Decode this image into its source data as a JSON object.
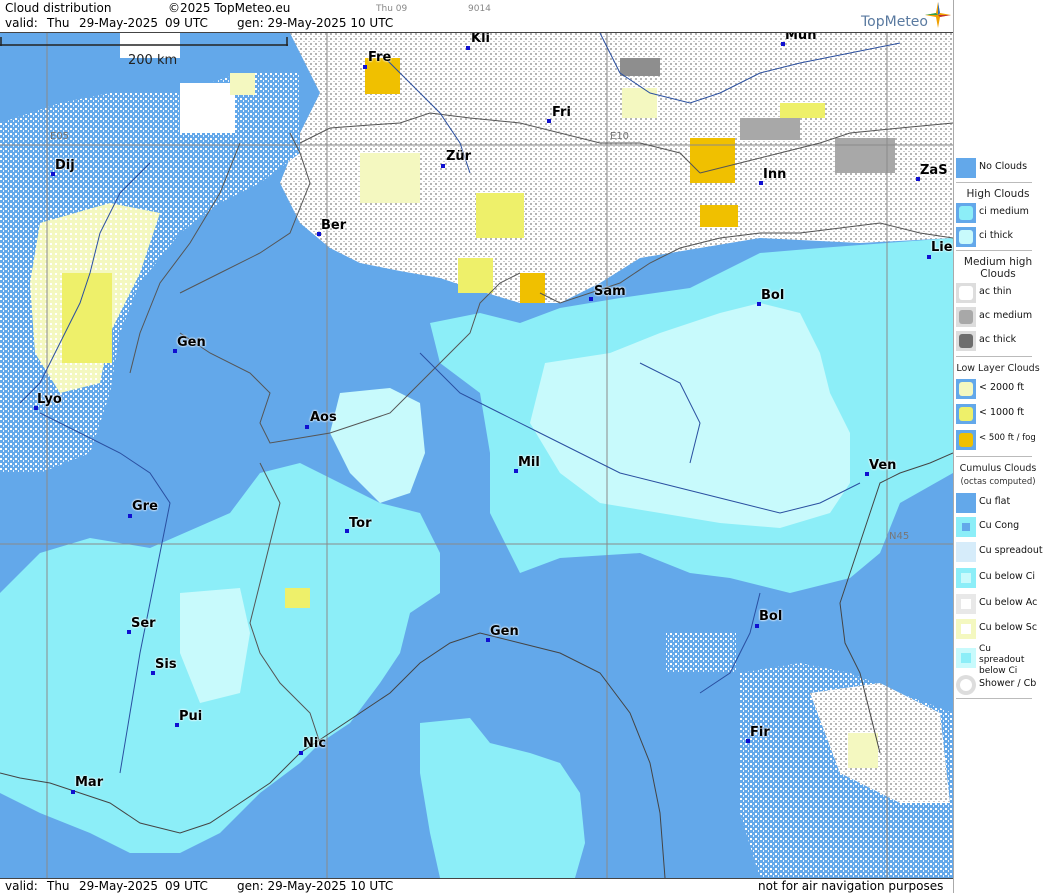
{
  "header": {
    "title": "Cloud distribution",
    "copyright": "©2025 TopMeteo.eu",
    "tiny_a": "Thu 09",
    "tiny_b": "9014",
    "valid_label": "valid:",
    "valid_day": "Thu",
    "valid_date": "29-May-2025",
    "valid_time": "09 UTC",
    "gen": "gen: 29-May-2025 10 UTC",
    "logo": "TopMeteo"
  },
  "scale": {
    "label": "200 km"
  },
  "grid": {
    "e05": "E05",
    "e10": "E10",
    "n45": "N45"
  },
  "cities": [
    {
      "name": "Mün"
    },
    {
      "name": "Kli"
    },
    {
      "name": "Fre"
    },
    {
      "name": "Fri"
    },
    {
      "name": "Dij"
    },
    {
      "name": "Zür"
    },
    {
      "name": "Inn"
    },
    {
      "name": "ZaS"
    },
    {
      "name": "Ber"
    },
    {
      "name": "Lie"
    },
    {
      "name": "Sam"
    },
    {
      "name": "Bol"
    },
    {
      "name": "Gen"
    },
    {
      "name": "Lyo"
    },
    {
      "name": "Aos"
    },
    {
      "name": "Mil"
    },
    {
      "name": "Ven"
    },
    {
      "name": "Gre"
    },
    {
      "name": "Tor"
    },
    {
      "name": "Ser"
    },
    {
      "name": "Gen"
    },
    {
      "name": "Bol"
    },
    {
      "name": "Sis"
    },
    {
      "name": "Pui"
    },
    {
      "name": "Nic"
    },
    {
      "name": "Fir"
    },
    {
      "name": "Mar"
    }
  ],
  "footer": {
    "valid_label": "valid:",
    "valid_day": "Thu",
    "valid_date": "29-May-2025",
    "valid_time": "09 UTC",
    "gen": "gen: 29-May-2025 10 UTC",
    "disclaimer": "not for air navigation purposes"
  },
  "legend": {
    "no_clouds": "No Clouds",
    "high_head": "High Clouds",
    "ci_medium": "ci medium",
    "ci_thick": "ci thick",
    "medium_head": "Medium high Clouds",
    "ac_thin": "ac thin",
    "ac_medium": "ac medium",
    "ac_thick": "ac thick",
    "low_head": "Low Layer Clouds",
    "low_2000": "< 2000 ft",
    "low_1000": "< 1000 ft",
    "low_500": "< 500 ft / fog",
    "cu_head": "Cumulus Clouds",
    "cu_sub": "(octas computed)",
    "cu_flat": "Cu flat",
    "cu_cong": "Cu Cong",
    "cu_spread": "Cu spreadout",
    "cu_below_ci": "Cu below Ci",
    "cu_below_ac": "Cu below Ac",
    "cu_below_sc": "Cu below Sc",
    "cu_spread_ci": "Cu spreadout below Ci",
    "shower": "Shower / Cb"
  },
  "colors": {
    "no_clouds": "#63a8ea",
    "ci_medium": "#8ceef8",
    "ci_thick": "#c8fafc",
    "ac_medium": "#a8a8a8",
    "ac_thick": "#6e6e6e",
    "low_2000": "#f4f8c0",
    "low_1000": "#eef06a",
    "low_500": "#f0c000"
  }
}
